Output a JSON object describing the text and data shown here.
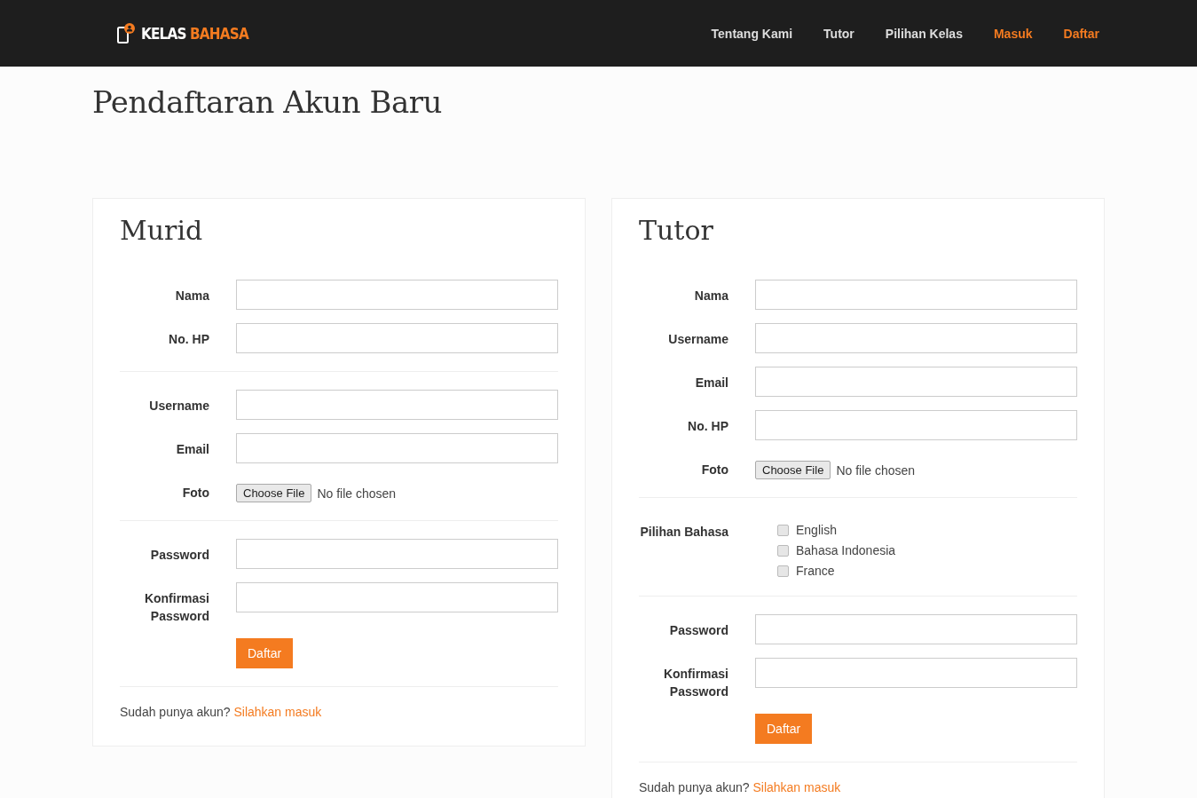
{
  "navbar": {
    "logo": {
      "first": "KELAS",
      "second": "BAHASA"
    },
    "links": [
      {
        "label": "Tentang Kami",
        "accent": false
      },
      {
        "label": "Tutor",
        "accent": false
      },
      {
        "label": "Pilihan Kelas",
        "accent": false
      },
      {
        "label": "Masuk",
        "accent": true
      },
      {
        "label": "Daftar",
        "accent": true
      }
    ]
  },
  "page_title": "Pendaftaran Akun Baru",
  "panels": [
    {
      "title": "Murid",
      "groups": [
        [
          {
            "kind": "text",
            "label": "Nama"
          },
          {
            "kind": "text",
            "label": "No. HP"
          }
        ],
        [
          {
            "kind": "text",
            "label": "Username"
          },
          {
            "kind": "text",
            "label": "Email"
          },
          {
            "kind": "file",
            "label": "Foto",
            "button": "Choose File",
            "status": "No file chosen"
          }
        ],
        [
          {
            "kind": "text",
            "label": "Password"
          },
          {
            "kind": "text",
            "label": "Konfirmasi Password"
          }
        ]
      ],
      "submit": "Daftar",
      "footer": {
        "text": "Sudah punya akun?",
        "link": "Silahkan masuk"
      }
    },
    {
      "title": "Tutor",
      "groups": [
        [
          {
            "kind": "text",
            "label": "Nama"
          },
          {
            "kind": "text",
            "label": "Username"
          },
          {
            "kind": "text",
            "label": "Email"
          },
          {
            "kind": "text",
            "label": "No. HP"
          },
          {
            "kind": "file",
            "label": "Foto",
            "button": "Choose File",
            "status": "No file chosen"
          }
        ],
        [
          {
            "kind": "checkboxes",
            "label": "Pilihan Bahasa",
            "options": [
              {
                "label": "English",
                "checked": false
              },
              {
                "label": "Bahasa Indonesia",
                "checked": false
              },
              {
                "label": "France",
                "checked": false
              }
            ]
          }
        ],
        [
          {
            "kind": "text",
            "label": "Password"
          },
          {
            "kind": "text",
            "label": "Konfirmasi Password"
          }
        ]
      ],
      "submit": "Daftar",
      "footer": {
        "text": "Sudah punya akun?",
        "link": "Silahkan masuk"
      }
    }
  ]
}
